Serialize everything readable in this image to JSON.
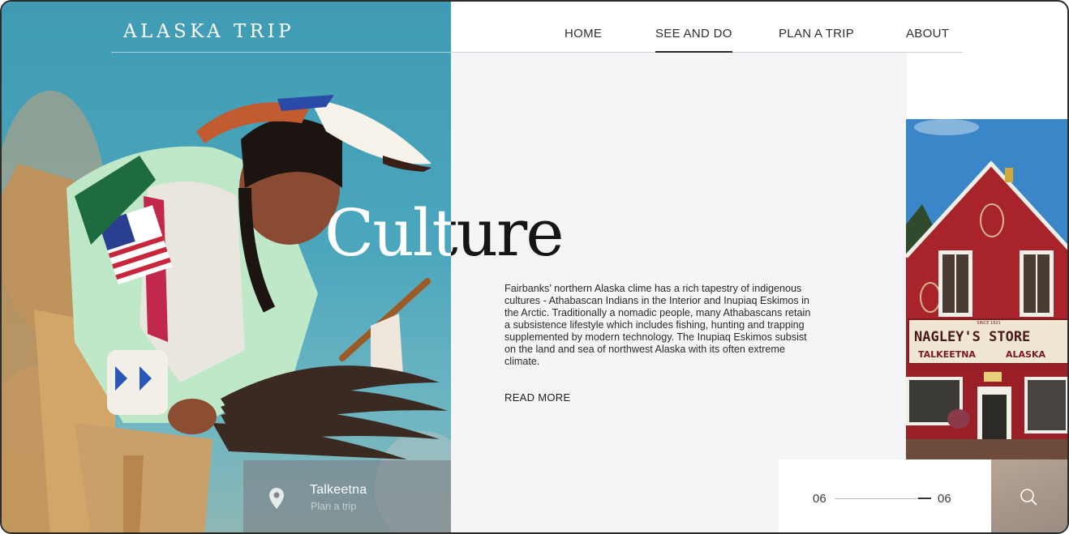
{
  "brand": {
    "name": "ALASKA TRIP"
  },
  "nav": {
    "items": [
      {
        "label": "HOME",
        "active": false
      },
      {
        "label": "SEE AND DO",
        "active": true
      },
      {
        "label": "PLAN A TRIP",
        "active": false
      },
      {
        "label": "ABOUT",
        "active": false
      }
    ]
  },
  "hero": {
    "title": "Culture",
    "description": "Fairbanks’ northern Alaska clime has a rich tapestry of indigenous cultures - Athabascan Indians in the Interior and Inupiaq Eskimos in the Arctic. Traditionally a nomadic people, many Athabascans retain a subsistence lifestyle which includes fishing, hunting and trapping supplemented by modern technology. The Inupiaq Eskimos subsist on the land and sea of northwest Alaska with its often extreme climate.",
    "read_more": "READ MORE"
  },
  "store_sign": {
    "name": "NAGLEY'S STORE",
    "town": "TALKEETNA",
    "state": "ALASKA",
    "since": "SINCE 1921"
  },
  "location": {
    "name": "Talkeetna",
    "subtitle": "Plan a trip",
    "icon": "map-pin-icon"
  },
  "slider": {
    "current": "06",
    "total": "06",
    "progress": 1.0
  },
  "search": {
    "icon": "search-icon"
  },
  "colors": {
    "sky": "#3f9cb4",
    "panel": "#f5f5f7",
    "store_red": "#b0222a",
    "text_dark": "#1e1e1e"
  }
}
